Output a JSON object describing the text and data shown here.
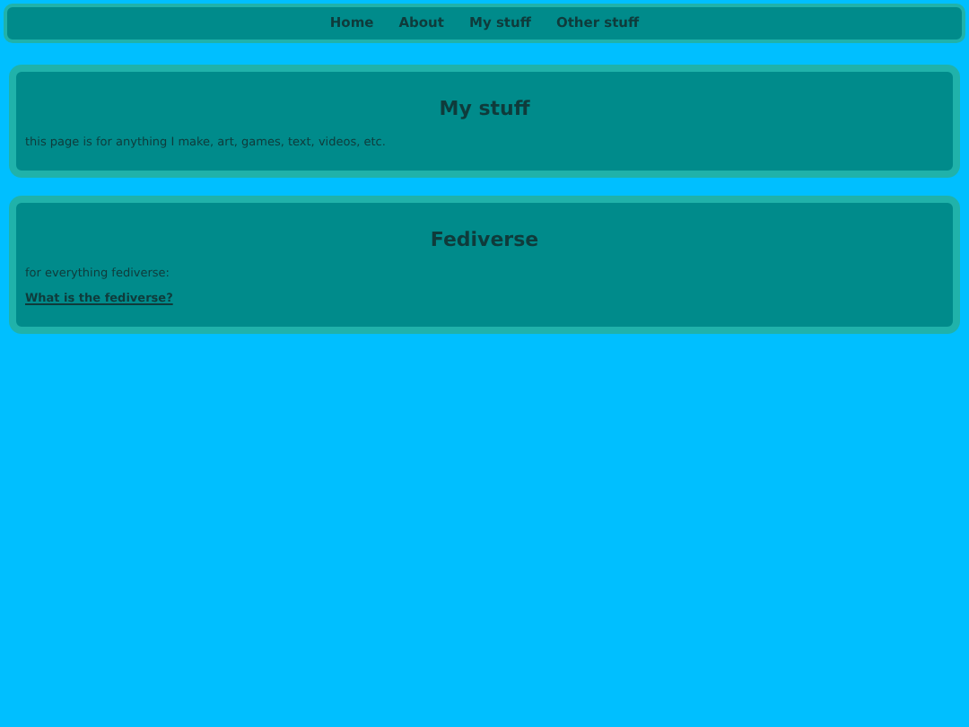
{
  "nav": {
    "links": [
      "Home",
      "About",
      "My stuff",
      "Other stuff"
    ]
  },
  "sections": [
    {
      "title": "My stuff",
      "items": [
        {
          "kind": "text",
          "text": "this page is for anything I make, art, games, text, videos, etc."
        }
      ]
    },
    {
      "title": "Fediverse",
      "items": [
        {
          "kind": "text",
          "text": "for everything fediverse:"
        },
        {
          "kind": "link",
          "text": "What is the fediverse?"
        }
      ]
    }
  ]
}
